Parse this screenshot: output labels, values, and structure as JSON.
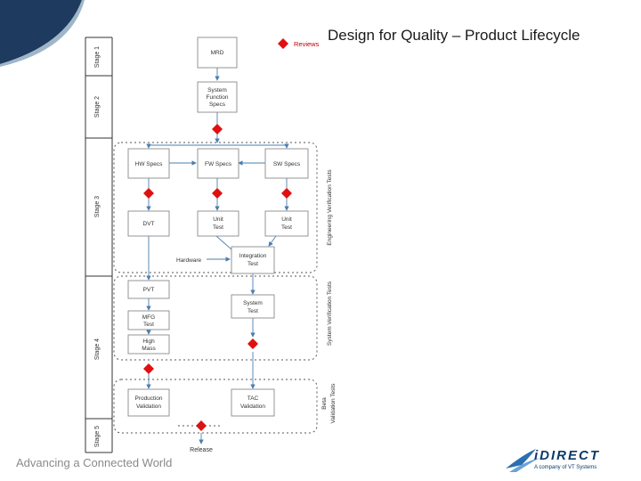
{
  "slide": {
    "title": "Design for Quality – Product Lifecycle",
    "footer": "Advancing a Connected World"
  },
  "logo": {
    "name": "iDIRECT",
    "tagline": "A company of VT Systems"
  },
  "legend": {
    "reviews": "Reviews"
  },
  "stages": [
    "Stage 1",
    "Stage 2",
    "Stage 3",
    "Stage 4",
    "Stage 5"
  ],
  "boxes": {
    "mrd": "MRD",
    "system_function_specs": [
      "System",
      "Function",
      "Specs"
    ],
    "hw_specs": "HW Specs",
    "fw_specs": "FW Specs",
    "sw_specs": "SW Specs",
    "dvt": "DVT",
    "unit_test_1": [
      "Unit",
      "Test"
    ],
    "unit_test_2": [
      "Unit",
      "Test"
    ],
    "integration_test": [
      "Integration",
      "Test"
    ],
    "pvt": "PVT",
    "system_test": [
      "System",
      "Test"
    ],
    "mfg_test": [
      "MFG",
      "Test"
    ],
    "high_mass": [
      "High",
      "Mass"
    ],
    "production_validation": [
      "Production",
      "Validation"
    ],
    "tac_validation": [
      "TAC",
      "Validation"
    ]
  },
  "labels": {
    "hardware": "Hardware",
    "release": "Release",
    "engineering_verification_tests": "Engineering Verification Tests",
    "system_verification_tests": "System Verification Tests",
    "beta_validation_tests": [
      "Beta",
      "Validation Tests"
    ]
  }
}
